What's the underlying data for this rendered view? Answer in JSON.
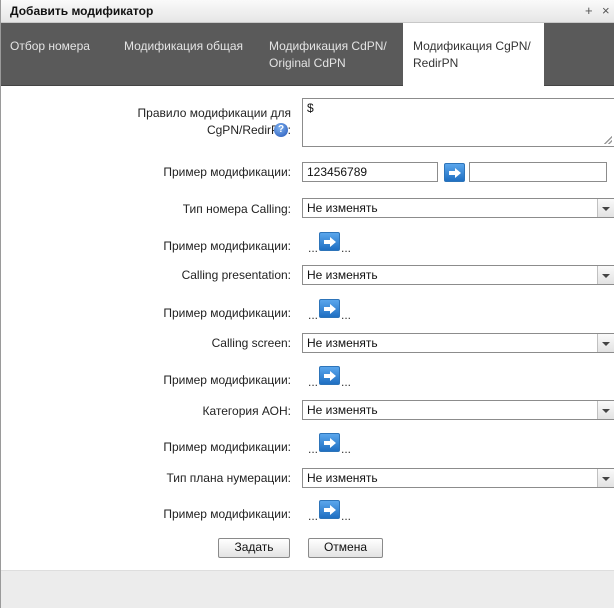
{
  "window": {
    "title": "Добавить модификатор",
    "controls": {
      "add": "+",
      "close": "×"
    }
  },
  "tabs": [
    {
      "label": "Отбор номера"
    },
    {
      "label": "Модификация общая"
    },
    {
      "label": "Модификация CdPN/ Original CdPN"
    },
    {
      "label": "Модификация CgPN/ RedirPN"
    }
  ],
  "active_tab": "Модификация CgPN/ RedirPN",
  "form": {
    "rule": {
      "label": "Правило модификации для CgPN/RedirPN:",
      "value": "$",
      "help_icon": "question-icon"
    },
    "example_main": {
      "label": "Пример модификации:",
      "input_value": "123456789",
      "result_value": ""
    },
    "calling_number_type": {
      "label": "Тип номера Calling:",
      "value": "Не изменять"
    },
    "example_1": {
      "label": "Пример модификации:",
      "dots": "...",
      "dots_after": "..."
    },
    "calling_presentation": {
      "label": "Calling presentation:",
      "value": "Не изменять"
    },
    "example_2": {
      "label": "Пример модификации:",
      "dots": "...",
      "dots_after": "..."
    },
    "calling_screen": {
      "label": "Calling screen:",
      "value": "Не изменять"
    },
    "example_3": {
      "label": "Пример модификации:",
      "dots": "...",
      "dots_after": "..."
    },
    "aon_category": {
      "label": "Категория АОН:",
      "value": "Не изменять"
    },
    "example_4": {
      "label": "Пример модификации:",
      "dots": "...",
      "dots_after": "..."
    },
    "numbering_plan_type": {
      "label": "Тип плана нумерации:",
      "value": "Не изменять"
    },
    "example_5": {
      "label": "Пример модификации:",
      "dots": "...",
      "dots_after": "..."
    }
  },
  "buttons": {
    "submit": "Задать",
    "cancel": "Отмена"
  },
  "colors": {
    "tab_bar": "#5a5a5a",
    "arrow_button": "#1f6fc2"
  }
}
